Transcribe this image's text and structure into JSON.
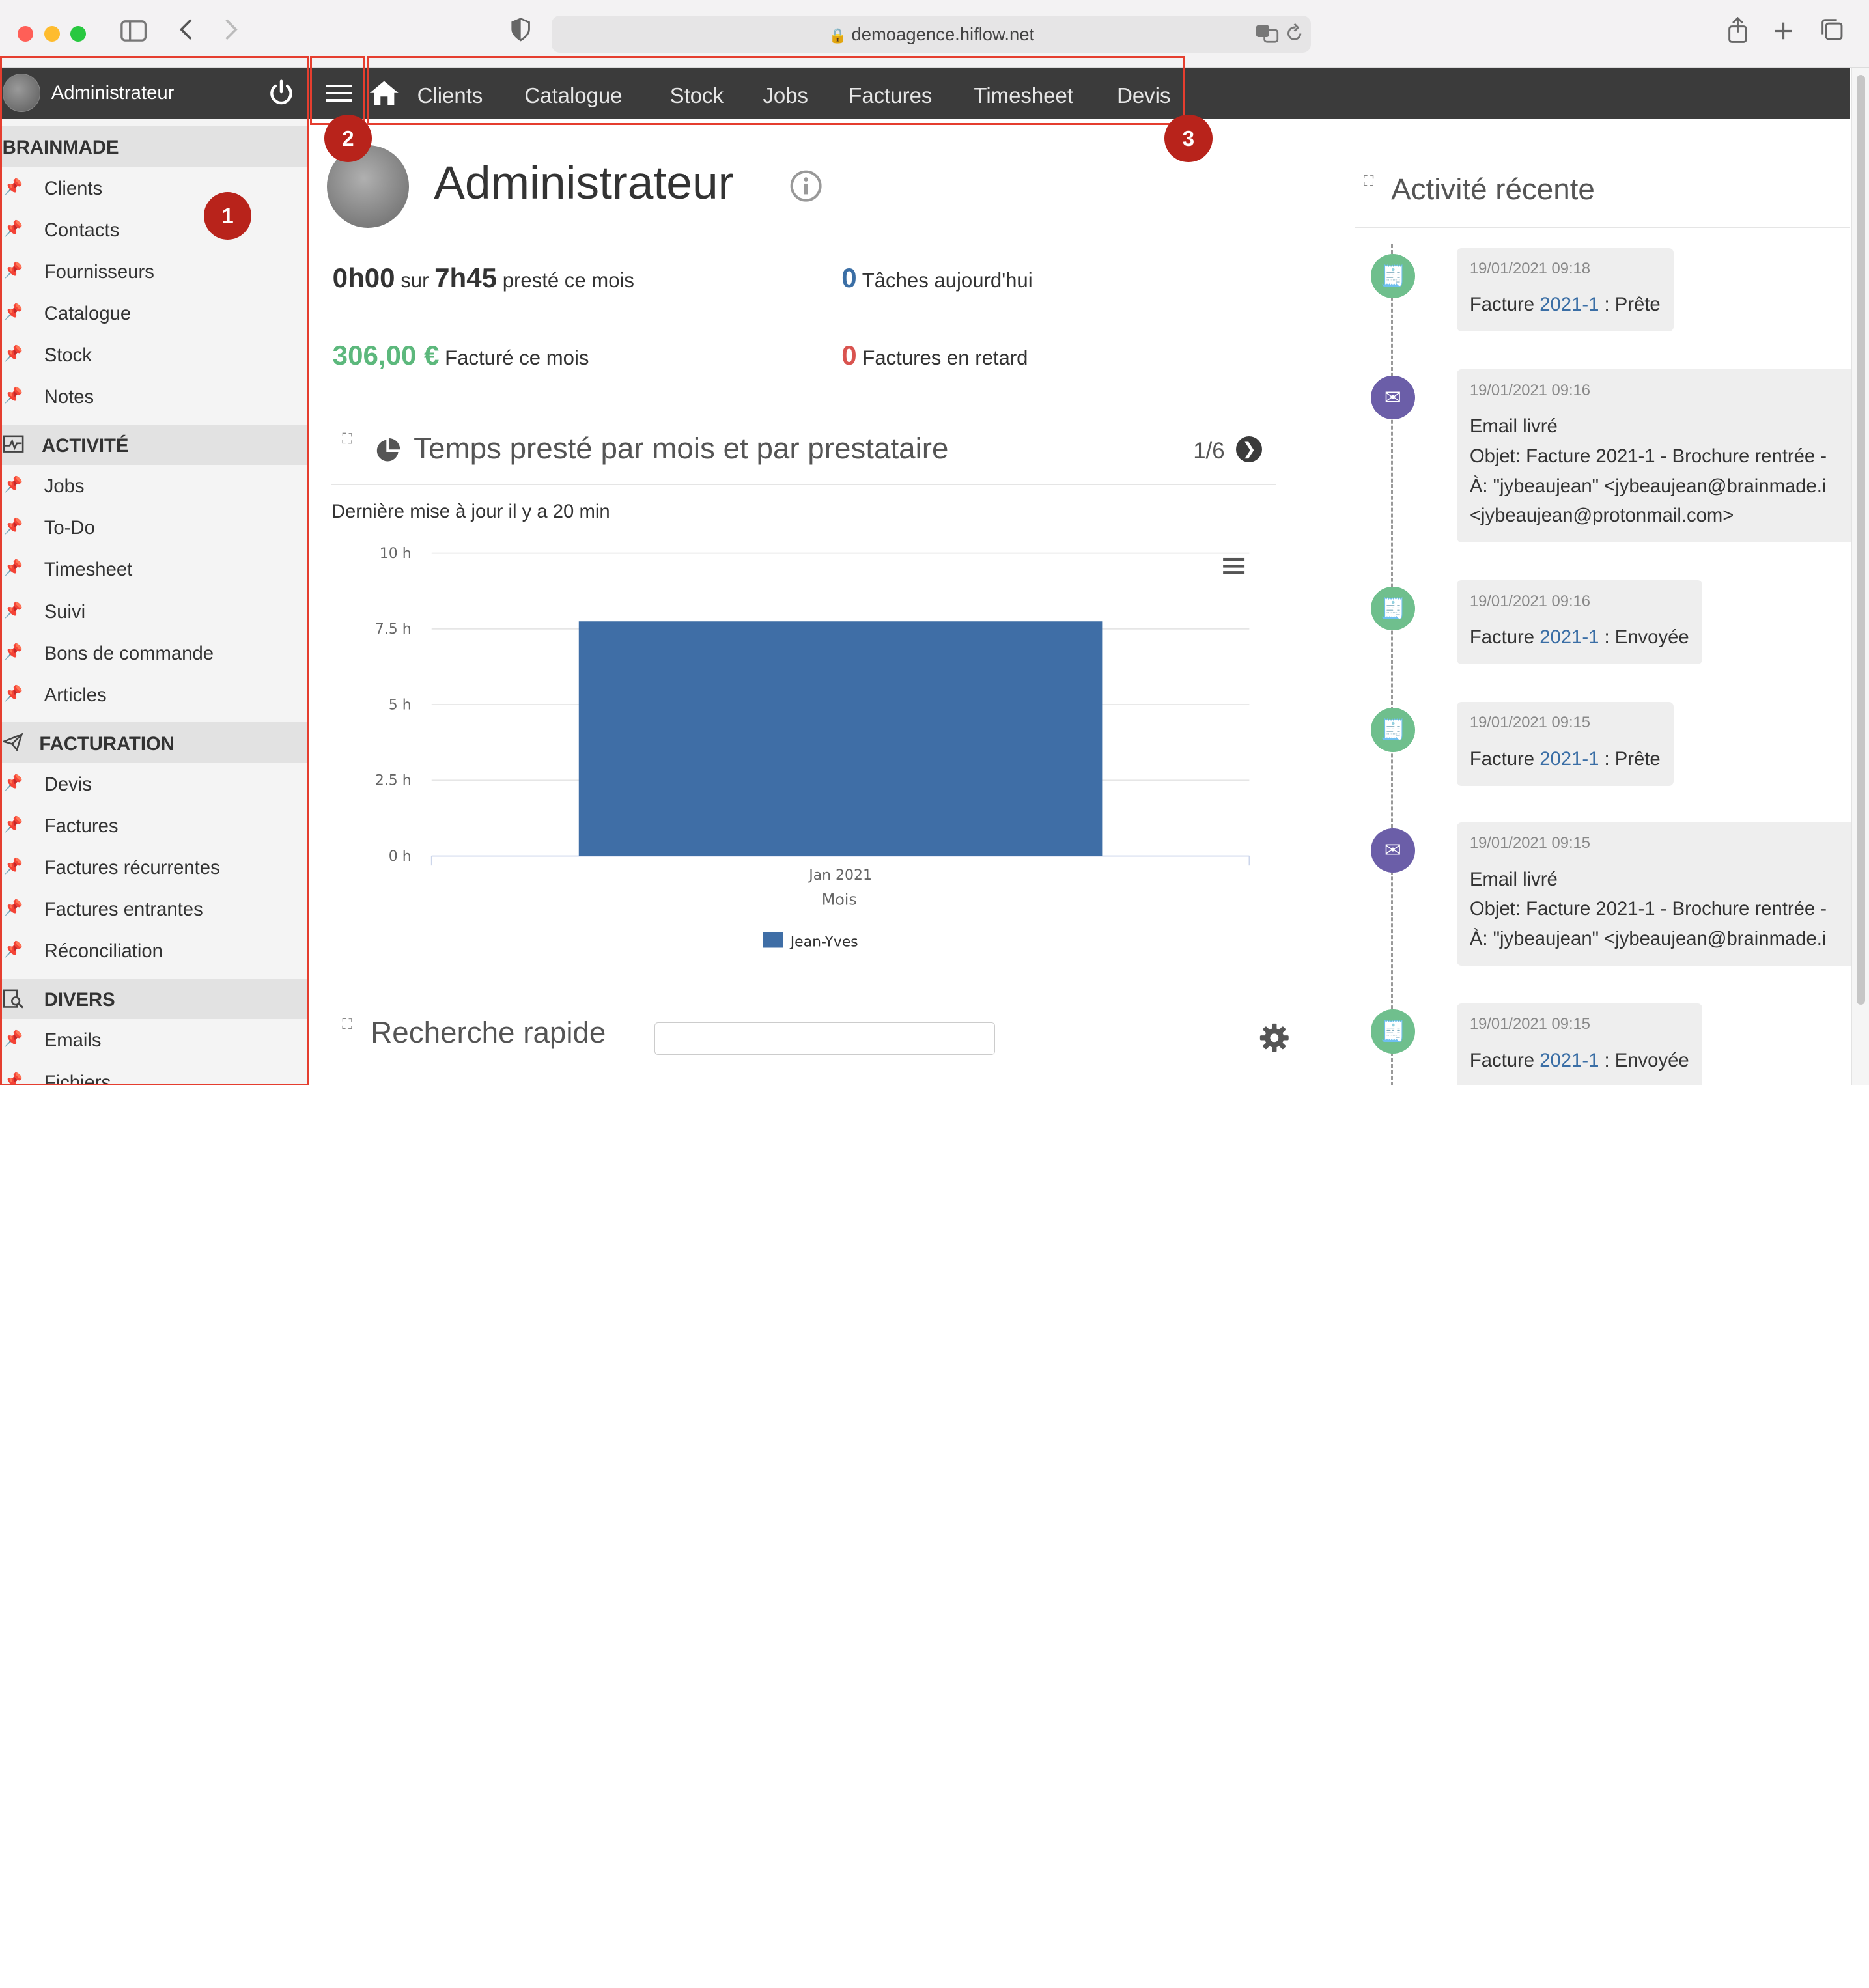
{
  "browser": {
    "url": "demoagence.hiflow.net"
  },
  "topnav": {
    "items": [
      "Clients",
      "Catalogue",
      "Stock",
      "Jobs",
      "Factures",
      "Timesheet",
      "Devis"
    ]
  },
  "sidebar": {
    "user": "Administrateur",
    "sections": [
      {
        "title": "BRAINMADE",
        "items": [
          {
            "label": "Clients",
            "pinned": true
          },
          {
            "label": "Contacts",
            "pinned": false
          },
          {
            "label": "Fournisseurs",
            "pinned": false
          },
          {
            "label": "Catalogue",
            "pinned": true
          },
          {
            "label": "Stock",
            "pinned": true
          },
          {
            "label": "Notes",
            "pinned": false
          }
        ]
      },
      {
        "title": "ACTIVITÉ",
        "items": [
          {
            "label": "Jobs",
            "pinned": true
          },
          {
            "label": "To-Do",
            "pinned": false
          },
          {
            "label": "Timesheet",
            "pinned": true
          },
          {
            "label": "Suivi",
            "pinned": false
          },
          {
            "label": "Bons de commande",
            "pinned": false
          },
          {
            "label": "Articles",
            "pinned": false
          }
        ]
      },
      {
        "title": "FACTURATION",
        "items": [
          {
            "label": "Devis",
            "pinned": true
          },
          {
            "label": "Factures",
            "pinned": true
          },
          {
            "label": "Factures récurrentes",
            "pinned": false
          },
          {
            "label": "Factures entrantes",
            "pinned": false
          },
          {
            "label": "Réconciliation",
            "pinned": false
          }
        ]
      },
      {
        "title": "DIVERS",
        "items": [
          {
            "label": "Emails",
            "pinned": false
          },
          {
            "label": "Fichiers",
            "pinned": false
          }
        ]
      }
    ]
  },
  "annotations": [
    "1",
    "2",
    "3"
  ],
  "profile": {
    "name": "Administrateur"
  },
  "stats": {
    "hours_done": "0h00",
    "hours_sep": "sur",
    "hours_total": "7h45",
    "hours_label": "presté ce mois",
    "tasks_count": "0",
    "tasks_label": "Tâches aujourd'hui",
    "invoiced_amount": "306,00 €",
    "invoiced_label": "Facturé ce mois",
    "late_count": "0",
    "late_label": "Factures en retard"
  },
  "chart_widget": {
    "title": "Temps presté par mois et par prestataire",
    "pager": "1/6",
    "updated": "Dernière mise à jour il y a 20 min"
  },
  "chart_data": {
    "type": "bar",
    "categories": [
      "Jan 2021"
    ],
    "series": [
      {
        "name": "Jean-Yves",
        "values": [
          7.75
        ]
      }
    ],
    "xlabel": "Mois",
    "ylabel": "",
    "ylim": [
      0,
      10
    ],
    "yticks": [
      "0 h",
      "2.5 h",
      "5 h",
      "7.5 h",
      "10 h"
    ],
    "colors": [
      "#3f6ea6"
    ],
    "grid": true,
    "legend": "bottom"
  },
  "search": {
    "title": "Recherche rapide",
    "value": ""
  },
  "activity": {
    "title": "Activité récente",
    "entries": [
      {
        "kind": "invoice",
        "date": "19/01/2021 09:18",
        "prefix": "Facture ",
        "link": "2021-1",
        "suffix": " : Prête"
      },
      {
        "kind": "email",
        "date": "19/01/2021 09:16",
        "lines": [
          "Email livré",
          "Objet: Facture 2021-1 - Brochure rentrée -",
          "À: \"jybeaujean\" <jybeaujean@brainmade.i",
          "<jybeaujean@protonmail.com>"
        ]
      },
      {
        "kind": "invoice",
        "date": "19/01/2021 09:16",
        "prefix": "Facture ",
        "link": "2021-1",
        "suffix": " : Envoyée"
      },
      {
        "kind": "invoice",
        "date": "19/01/2021 09:15",
        "prefix": "Facture ",
        "link": "2021-1",
        "suffix": " : Prête"
      },
      {
        "kind": "email",
        "date": "19/01/2021 09:15",
        "lines": [
          "Email livré",
          "Objet: Facture 2021-1 - Brochure rentrée -",
          "À: \"jybeaujean\" <jybeaujean@brainmade.i"
        ]
      },
      {
        "kind": "invoice",
        "date": "19/01/2021 09:15",
        "prefix": "Facture ",
        "link": "2021-1",
        "suffix": " : Envoyée"
      }
    ]
  }
}
